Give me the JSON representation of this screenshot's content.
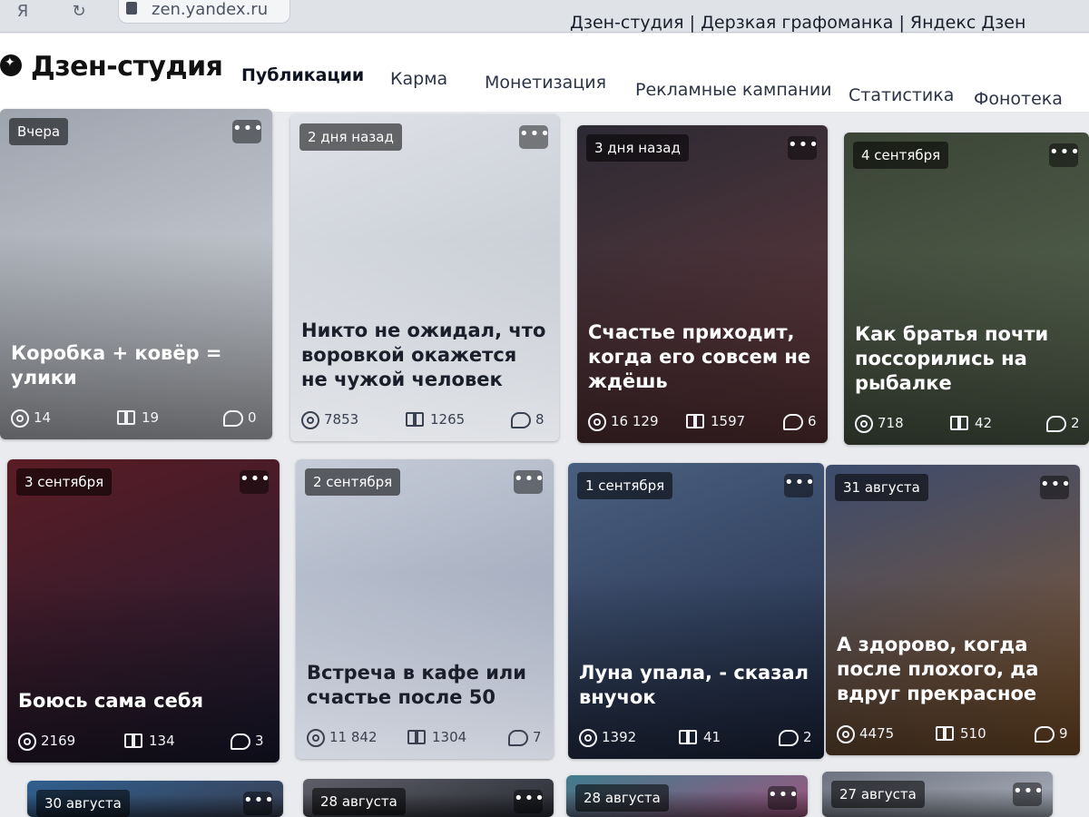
{
  "browser": {
    "url": "zen.yandex.ru",
    "window_title": "Дзен-студия | Дерзкая графоманка | Яндекс Дзен"
  },
  "header": {
    "logo_text": "Дзен-студия",
    "tabs": [
      {
        "label": "Публикации",
        "active": true
      },
      {
        "label": "Карма"
      },
      {
        "label": "Монетизация"
      },
      {
        "label": "Рекламные кампании"
      },
      {
        "label": "Статистика"
      },
      {
        "label": "Фонотека"
      }
    ]
  },
  "cards": [
    {
      "date": "Вчера",
      "title": "Коробка + ковёр = улики",
      "views": "14",
      "reads": "19",
      "comments": "0",
      "bg": "#9ea4ae",
      "bg2": "#d9dce2",
      "light": false
    },
    {
      "date": "2 дня назад",
      "title": "Никто не ожидал, что воровкой окажется не чужой человек",
      "views": "7853",
      "reads": "1265",
      "comments": "8",
      "bg": "#dfe2e8",
      "bg2": "#b9bec7",
      "light": true
    },
    {
      "date": "3 дня назад",
      "title": "Счастье приходит, когда его совсем не ждёшь",
      "views": "16 129",
      "reads": "1597",
      "comments": "6",
      "bg": "#2c2a33",
      "bg2": "#6a3b3f",
      "light": false
    },
    {
      "date": "4 сентября",
      "title": "Как братья почти поссорились на рыбалке",
      "views": "718",
      "reads": "42",
      "comments": "2",
      "bg": "#3b4436",
      "bg2": "#5c6b55",
      "light": false
    },
    {
      "date": "3 сентября",
      "title": "Боюсь сама себя",
      "views": "2169",
      "reads": "134",
      "comments": "3",
      "bg": "#5a1c24",
      "bg2": "#1c1d36",
      "light": false
    },
    {
      "date": "2 сентября",
      "title": "Встреча в кафе или счастье после 50",
      "views": "11 842",
      "reads": "1304",
      "comments": "7",
      "bg": "#c6ccd8",
      "bg2": "#8e98ad",
      "light": true
    },
    {
      "date": "1 сентября",
      "title": "Луна упала, - сказал внучок",
      "views": "1392",
      "reads": "41",
      "comments": "2",
      "bg": "#4a5f80",
      "bg2": "#1f2a44",
      "light": false
    },
    {
      "date": "31 августа",
      "title": "А здорово, когда после плохого, да вдруг прекрасное",
      "views": "4475",
      "reads": "510",
      "comments": "9",
      "bg": "#3c4b6d",
      "bg2": "#8a5a2c",
      "light": false
    },
    {
      "date": "30 августа",
      "bg": "#2f5f8f",
      "bg2": "#3a3f52",
      "light": false
    },
    {
      "date": "28 августа",
      "bg": "#5e5f68",
      "bg2": "#2b2d36",
      "light": false
    },
    {
      "date": "28 августа",
      "bg": "#3f7c8c",
      "bg2": "#a0557f",
      "light": false
    },
    {
      "date": "27 августа",
      "bg": "#6d7280",
      "bg2": "#aab0bb",
      "light": false
    }
  ]
}
